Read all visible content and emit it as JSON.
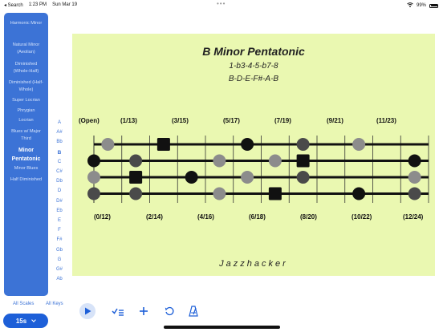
{
  "status_bar": {
    "back_label": "◂ Search",
    "time": "1:23 PM",
    "date": "Sun Mar 19",
    "battery": "99%"
  },
  "sidebar": {
    "items": [
      {
        "label": "Harmonic Minor"
      },
      {
        "label": "Natural Minor (Aeolian)"
      },
      {
        "label": "Diminished (Whole-Half)"
      },
      {
        "label": "Diminished (Half-Whole)"
      },
      {
        "label": "Super Locrian"
      },
      {
        "label": "Phrygian"
      },
      {
        "label": "Locrian"
      },
      {
        "label": "Blues w/ Major Third"
      },
      {
        "label": "Minor Pentatonic"
      },
      {
        "label": "Minor Blues"
      },
      {
        "label": "Half Diminished"
      }
    ],
    "selected_index": 8
  },
  "keys": {
    "items": [
      "A",
      "A#",
      "Bb",
      "B",
      "C",
      "C#",
      "Db",
      "D",
      "D#",
      "Eb",
      "E",
      "F",
      "F#",
      "Gb",
      "G",
      "G#",
      "Ab"
    ],
    "selected_index": 3
  },
  "footer": {
    "all_scales": "All Scales",
    "all_keys": "All Keys",
    "tempo": "15s"
  },
  "toolbar": {
    "icons": [
      "play-icon",
      "checklist-icon",
      "plus-icon",
      "rotate-icon",
      "metronome-icon"
    ]
  },
  "main": {
    "title": "B Minor Pentatonic",
    "formula": "1-b3-4-5-b7-8",
    "notes": "B-D-E-F#-A-B",
    "brand": "Jazzhacker",
    "top_fret_labels": [
      "(Open)",
      "(1/13)",
      "(3/15)",
      "(5/17)",
      "(7/19)",
      "(9/21)",
      "(11/23)"
    ],
    "bottom_fret_labels": [
      "(0/12)",
      "(2/14)",
      "(4/16)",
      "(6/18)",
      "(8/20)",
      "(10/22)",
      "(12/24)"
    ]
  },
  "fretboard": {
    "strings": 4,
    "frets": 12,
    "note_colors": {
      "black": "#111111",
      "dark": "#4a4a4a",
      "light": "#8c8c8c"
    },
    "notes": [
      {
        "string": 1,
        "fret": 1,
        "color": "light",
        "shape": "circle"
      },
      {
        "string": 1,
        "fret": 3,
        "color": "black",
        "shape": "square"
      },
      {
        "string": 1,
        "fret": 6,
        "color": "black",
        "shape": "circle"
      },
      {
        "string": 1,
        "fret": 8,
        "color": "dark",
        "shape": "circle"
      },
      {
        "string": 1,
        "fret": 10,
        "color": "light",
        "shape": "circle"
      },
      {
        "string": 2,
        "fret": 0,
        "color": "black",
        "shape": "circle"
      },
      {
        "string": 2,
        "fret": 2,
        "color": "dark",
        "shape": "circle"
      },
      {
        "string": 2,
        "fret": 5,
        "color": "light",
        "shape": "circle"
      },
      {
        "string": 2,
        "fret": 7,
        "color": "light",
        "shape": "circle"
      },
      {
        "string": 2,
        "fret": 8,
        "color": "black",
        "shape": "square"
      },
      {
        "string": 2,
        "fret": 12,
        "color": "black",
        "shape": "circle"
      },
      {
        "string": 3,
        "fret": 0,
        "color": "light",
        "shape": "circle"
      },
      {
        "string": 3,
        "fret": 2,
        "color": "black",
        "shape": "square"
      },
      {
        "string": 3,
        "fret": 4,
        "color": "black",
        "shape": "circle"
      },
      {
        "string": 3,
        "fret": 6,
        "color": "light",
        "shape": "circle"
      },
      {
        "string": 3,
        "fret": 8,
        "color": "dark",
        "shape": "circle"
      },
      {
        "string": 3,
        "fret": 12,
        "color": "light",
        "shape": "circle"
      },
      {
        "string": 4,
        "fret": 0,
        "color": "dark",
        "shape": "circle"
      },
      {
        "string": 4,
        "fret": 2,
        "color": "dark",
        "shape": "circle"
      },
      {
        "string": 4,
        "fret": 5,
        "color": "light",
        "shape": "circle"
      },
      {
        "string": 4,
        "fret": 7,
        "color": "black",
        "shape": "square"
      },
      {
        "string": 4,
        "fret": 10,
        "color": "black",
        "shape": "circle"
      },
      {
        "string": 4,
        "fret": 12,
        "color": "dark",
        "shape": "circle"
      }
    ]
  }
}
